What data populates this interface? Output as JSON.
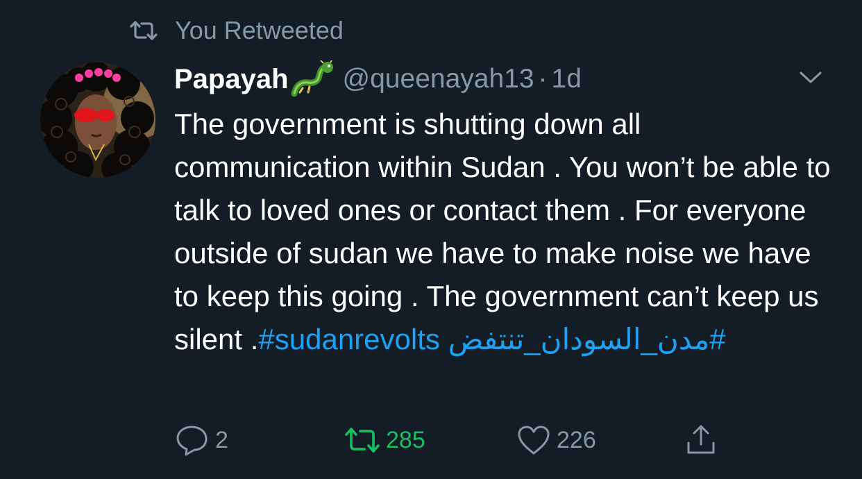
{
  "context": {
    "retweeted_label": "You Retweeted"
  },
  "author": {
    "display_name": "Papayah",
    "handle": "@queenayah13",
    "separator": "·",
    "time": "1d"
  },
  "tweet": {
    "body": "The government is shutting down all communication within Sudan . You won’t be able to talk to loved ones or contact them . For everyone outside of sudan we have to make noise we have to keep this going . The government can’t keep us silent .",
    "hashtag_1": "#sudanrevolts",
    "hashtag_2": "#مدن_السودان_تنتفض"
  },
  "actions": {
    "reply_count": "2",
    "retweet_count": "285",
    "like_count": "226"
  },
  "colors": {
    "background": "#141d26",
    "secondary_text": "#8899a6",
    "link": "#1da1f2",
    "retweet_active": "#17bf63"
  },
  "icons": {
    "retweet_context": "retweet-icon",
    "name_emoji": "dragon-emoji",
    "menu": "chevron-down-icon",
    "reply": "reply-icon",
    "retweet": "retweet-icon",
    "like": "heart-icon",
    "share": "share-icon"
  }
}
